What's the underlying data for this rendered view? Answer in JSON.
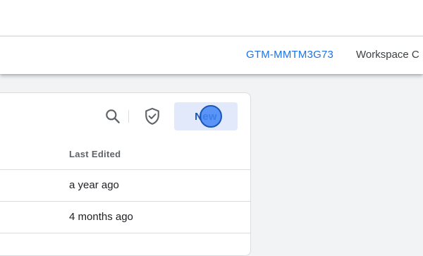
{
  "header": {
    "container_id": "GTM-MMTM3G73",
    "workspace_label": "Workspace C"
  },
  "toolbar": {
    "search_icon": "search-icon",
    "shield_icon": "shield-check-icon",
    "new_label": "New"
  },
  "table": {
    "columns": [
      "Last Edited"
    ],
    "rows": [
      {
        "last_edited": "a year ago"
      },
      {
        "last_edited": "4 months ago"
      }
    ]
  },
  "colors": {
    "accent": "#1a73e8",
    "new_button_bg": "#e1e9fb",
    "click_marker": "#4285f4"
  }
}
